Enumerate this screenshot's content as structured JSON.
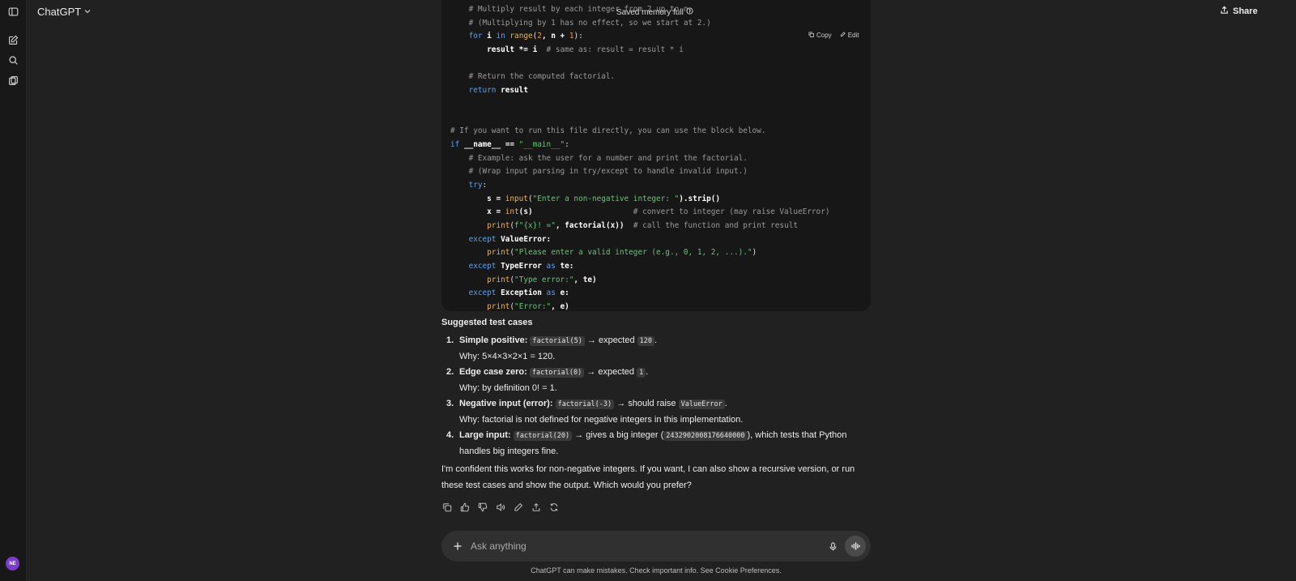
{
  "header": {
    "brand": "ChatGPT",
    "saved_memory": "Saved memory full",
    "share": "Share"
  },
  "sidebar": {
    "avatar_initials": "NE"
  },
  "code_block": {
    "copy_label": "Copy",
    "edit_label": "Edit",
    "lines": [
      [
        {
          "t": "    # Multiply result by each integer from 2 up to n.",
          "c": "cm"
        }
      ],
      [
        {
          "t": "    # (Multiplying by 1 has no effect, so we start at 2.)",
          "c": "cm"
        }
      ],
      [
        {
          "t": "    ",
          "c": ""
        },
        {
          "t": "for",
          "c": "kw"
        },
        {
          "t": " i ",
          "c": "nf"
        },
        {
          "t": "in",
          "c": "kw"
        },
        {
          "t": " ",
          "c": ""
        },
        {
          "t": "range",
          "c": "fn"
        },
        {
          "t": "(",
          "c": ""
        },
        {
          "t": "2",
          "c": "nm"
        },
        {
          "t": ", n + ",
          "c": "nf"
        },
        {
          "t": "1",
          "c": "nm"
        },
        {
          "t": "):",
          "c": ""
        }
      ],
      [
        {
          "t": "        result *= i  ",
          "c": "nf"
        },
        {
          "t": "# same as: result = result * i",
          "c": "cm"
        }
      ],
      [
        {
          "t": "",
          "c": ""
        }
      ],
      [
        {
          "t": "    # Return the computed factorial.",
          "c": "cm"
        }
      ],
      [
        {
          "t": "    ",
          "c": ""
        },
        {
          "t": "return",
          "c": "kw"
        },
        {
          "t": " result",
          "c": "nf"
        }
      ],
      [
        {
          "t": "",
          "c": ""
        }
      ],
      [
        {
          "t": "",
          "c": ""
        }
      ],
      [
        {
          "t": "# If you want to run this file directly, you can use the block below.",
          "c": "cm"
        }
      ],
      [
        {
          "t": "if",
          "c": "kw"
        },
        {
          "t": " __name__ == ",
          "c": "nf"
        },
        {
          "t": "\"__main__\"",
          "c": "st"
        },
        {
          "t": ":",
          "c": ""
        }
      ],
      [
        {
          "t": "    # Example: ask the user for a number and print the factorial.",
          "c": "cm"
        }
      ],
      [
        {
          "t": "    # (Wrap input parsing in try/except to handle invalid input.)",
          "c": "cm"
        }
      ],
      [
        {
          "t": "    ",
          "c": ""
        },
        {
          "t": "try",
          "c": "kw"
        },
        {
          "t": ":",
          "c": ""
        }
      ],
      [
        {
          "t": "        s = ",
          "c": "nf"
        },
        {
          "t": "input",
          "c": "fn"
        },
        {
          "t": "(",
          "c": ""
        },
        {
          "t": "\"Enter a non-negative integer: \"",
          "c": "st"
        },
        {
          "t": ").strip()",
          "c": "nf"
        }
      ],
      [
        {
          "t": "        x = ",
          "c": "nf"
        },
        {
          "t": "int",
          "c": "fn"
        },
        {
          "t": "(s)                      ",
          "c": "nf"
        },
        {
          "t": "# convert to integer (may raise ValueError)",
          "c": "cm"
        }
      ],
      [
        {
          "t": "        ",
          "c": ""
        },
        {
          "t": "print",
          "c": "fn"
        },
        {
          "t": "(",
          "c": ""
        },
        {
          "t": "f\"{x}! =\"",
          "c": "st"
        },
        {
          "t": ", factorial(x))  ",
          "c": "nf"
        },
        {
          "t": "# call the function and print result",
          "c": "cm"
        }
      ],
      [
        {
          "t": "    ",
          "c": ""
        },
        {
          "t": "except",
          "c": "kw"
        },
        {
          "t": " ValueError:",
          "c": "nf"
        }
      ],
      [
        {
          "t": "        ",
          "c": ""
        },
        {
          "t": "print",
          "c": "fn"
        },
        {
          "t": "(",
          "c": ""
        },
        {
          "t": "\"Please enter a valid integer (e.g., 0, 1, 2, ...).\"",
          "c": "st"
        },
        {
          "t": ")",
          "c": ""
        }
      ],
      [
        {
          "t": "    ",
          "c": ""
        },
        {
          "t": "except",
          "c": "kw"
        },
        {
          "t": " TypeError ",
          "c": "nf"
        },
        {
          "t": "as",
          "c": "kw"
        },
        {
          "t": " te:",
          "c": "nf"
        }
      ],
      [
        {
          "t": "        ",
          "c": ""
        },
        {
          "t": "print",
          "c": "fn"
        },
        {
          "t": "(",
          "c": ""
        },
        {
          "t": "\"Type error:\"",
          "c": "st"
        },
        {
          "t": ", te)",
          "c": "nf"
        }
      ],
      [
        {
          "t": "    ",
          "c": ""
        },
        {
          "t": "except",
          "c": "kw"
        },
        {
          "t": " Exception ",
          "c": "nf"
        },
        {
          "t": "as",
          "c": "kw"
        },
        {
          "t": " e:",
          "c": "nf"
        }
      ],
      [
        {
          "t": "        ",
          "c": ""
        },
        {
          "t": "print",
          "c": "fn"
        },
        {
          "t": "(",
          "c": ""
        },
        {
          "t": "\"Error:\"",
          "c": "st"
        },
        {
          "t": ", e)",
          "c": "nf"
        }
      ]
    ]
  },
  "answer": {
    "heading": "Suggested test cases",
    "items": [
      {
        "num": "1.",
        "label": "Simple positive:",
        "code1": "factorial(5)",
        "mid": " → expected ",
        "code2": "120",
        "tail": ".",
        "why": "Why: 5×4×3×2×1 = 120."
      },
      {
        "num": "2.",
        "label": "Edge case zero:",
        "code1": "factorial(0)",
        "mid": " → expected ",
        "code2": "1",
        "tail": ".",
        "why": "Why: by definition 0! = 1."
      },
      {
        "num": "3.",
        "label": "Negative input (error):",
        "code1": "factorial(-3)",
        "mid": " → should raise ",
        "code2": "ValueError",
        "tail": ".",
        "why": "Why: factorial is not defined for negative integers in this implementation."
      },
      {
        "num": "4.",
        "label": "Large input:",
        "code1": "factorial(20)",
        "mid": " → gives a big integer (",
        "code2": "2432902008176640000",
        "tail": "), which tests that Python",
        "why": "handles big integers fine."
      }
    ],
    "closing_line1": "I'm confident this works for non-negative integers. If you want, I can also show a recursive version, or run",
    "closing_line2": "these test cases and show the output. Which would you prefer?"
  },
  "composer": {
    "placeholder": "Ask anything"
  },
  "footer": {
    "disclaimer": "ChatGPT can make mistakes. Check important info. See Cookie Preferences."
  },
  "icons": {
    "sidebar_toggle": "sidebar-toggle-icon",
    "new_chat": "new-chat-icon",
    "search": "search-icon",
    "library": "library-icon",
    "copy": "copy-icon",
    "thumbs_up": "thumbs-up-icon",
    "thumbs_down": "thumbs-down-icon",
    "read_aloud": "speaker-icon",
    "edit": "pencil-icon",
    "share": "share-icon",
    "regenerate": "refresh-icon",
    "plus": "plus-icon",
    "mic": "mic-icon",
    "voice": "voice-wave-icon"
  },
  "colors": {
    "background": "#212121",
    "code_background": "#171717",
    "keyword": "#5aa2f0",
    "string": "#69c27a",
    "number": "#e8985f",
    "comment": "#9a9a9a",
    "avatar": "#7e3ccf"
  }
}
